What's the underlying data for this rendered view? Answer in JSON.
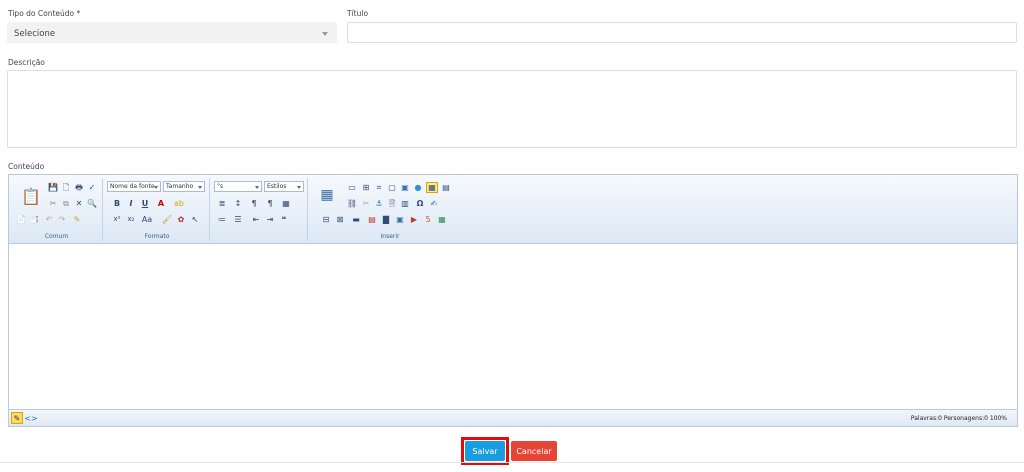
{
  "form": {
    "tipo_label": "Tipo do Conteúdo *",
    "tipo_value": "Selecione",
    "titulo_label": "Título",
    "titulo_value": "",
    "descricao_label": "Descrição",
    "descricao_value": "",
    "conteudo_label": "Conteúdo"
  },
  "toolbar": {
    "groups": {
      "comum": "Comum",
      "formato": "Formato",
      "paragrafo": "°s",
      "inserir": "Inserir"
    },
    "font_name": "Nome da fonte",
    "font_size": "Tamanho",
    "paragraph": "°s",
    "styles": "Estilos",
    "bold": "B",
    "italic": "I",
    "underline": "U",
    "font_color": "A",
    "superscript": "x²",
    "subscript": "x₂",
    "omega": "Ω",
    "quote": "❝"
  },
  "status": {
    "text": "Palavras:0 Personagens:0   100%"
  },
  "buttons": {
    "save": "Salvar",
    "cancel": "Cancelar"
  },
  "colors": {
    "save": "#1a9de0",
    "cancel": "#e64535",
    "highlight": "#e10c0c"
  }
}
